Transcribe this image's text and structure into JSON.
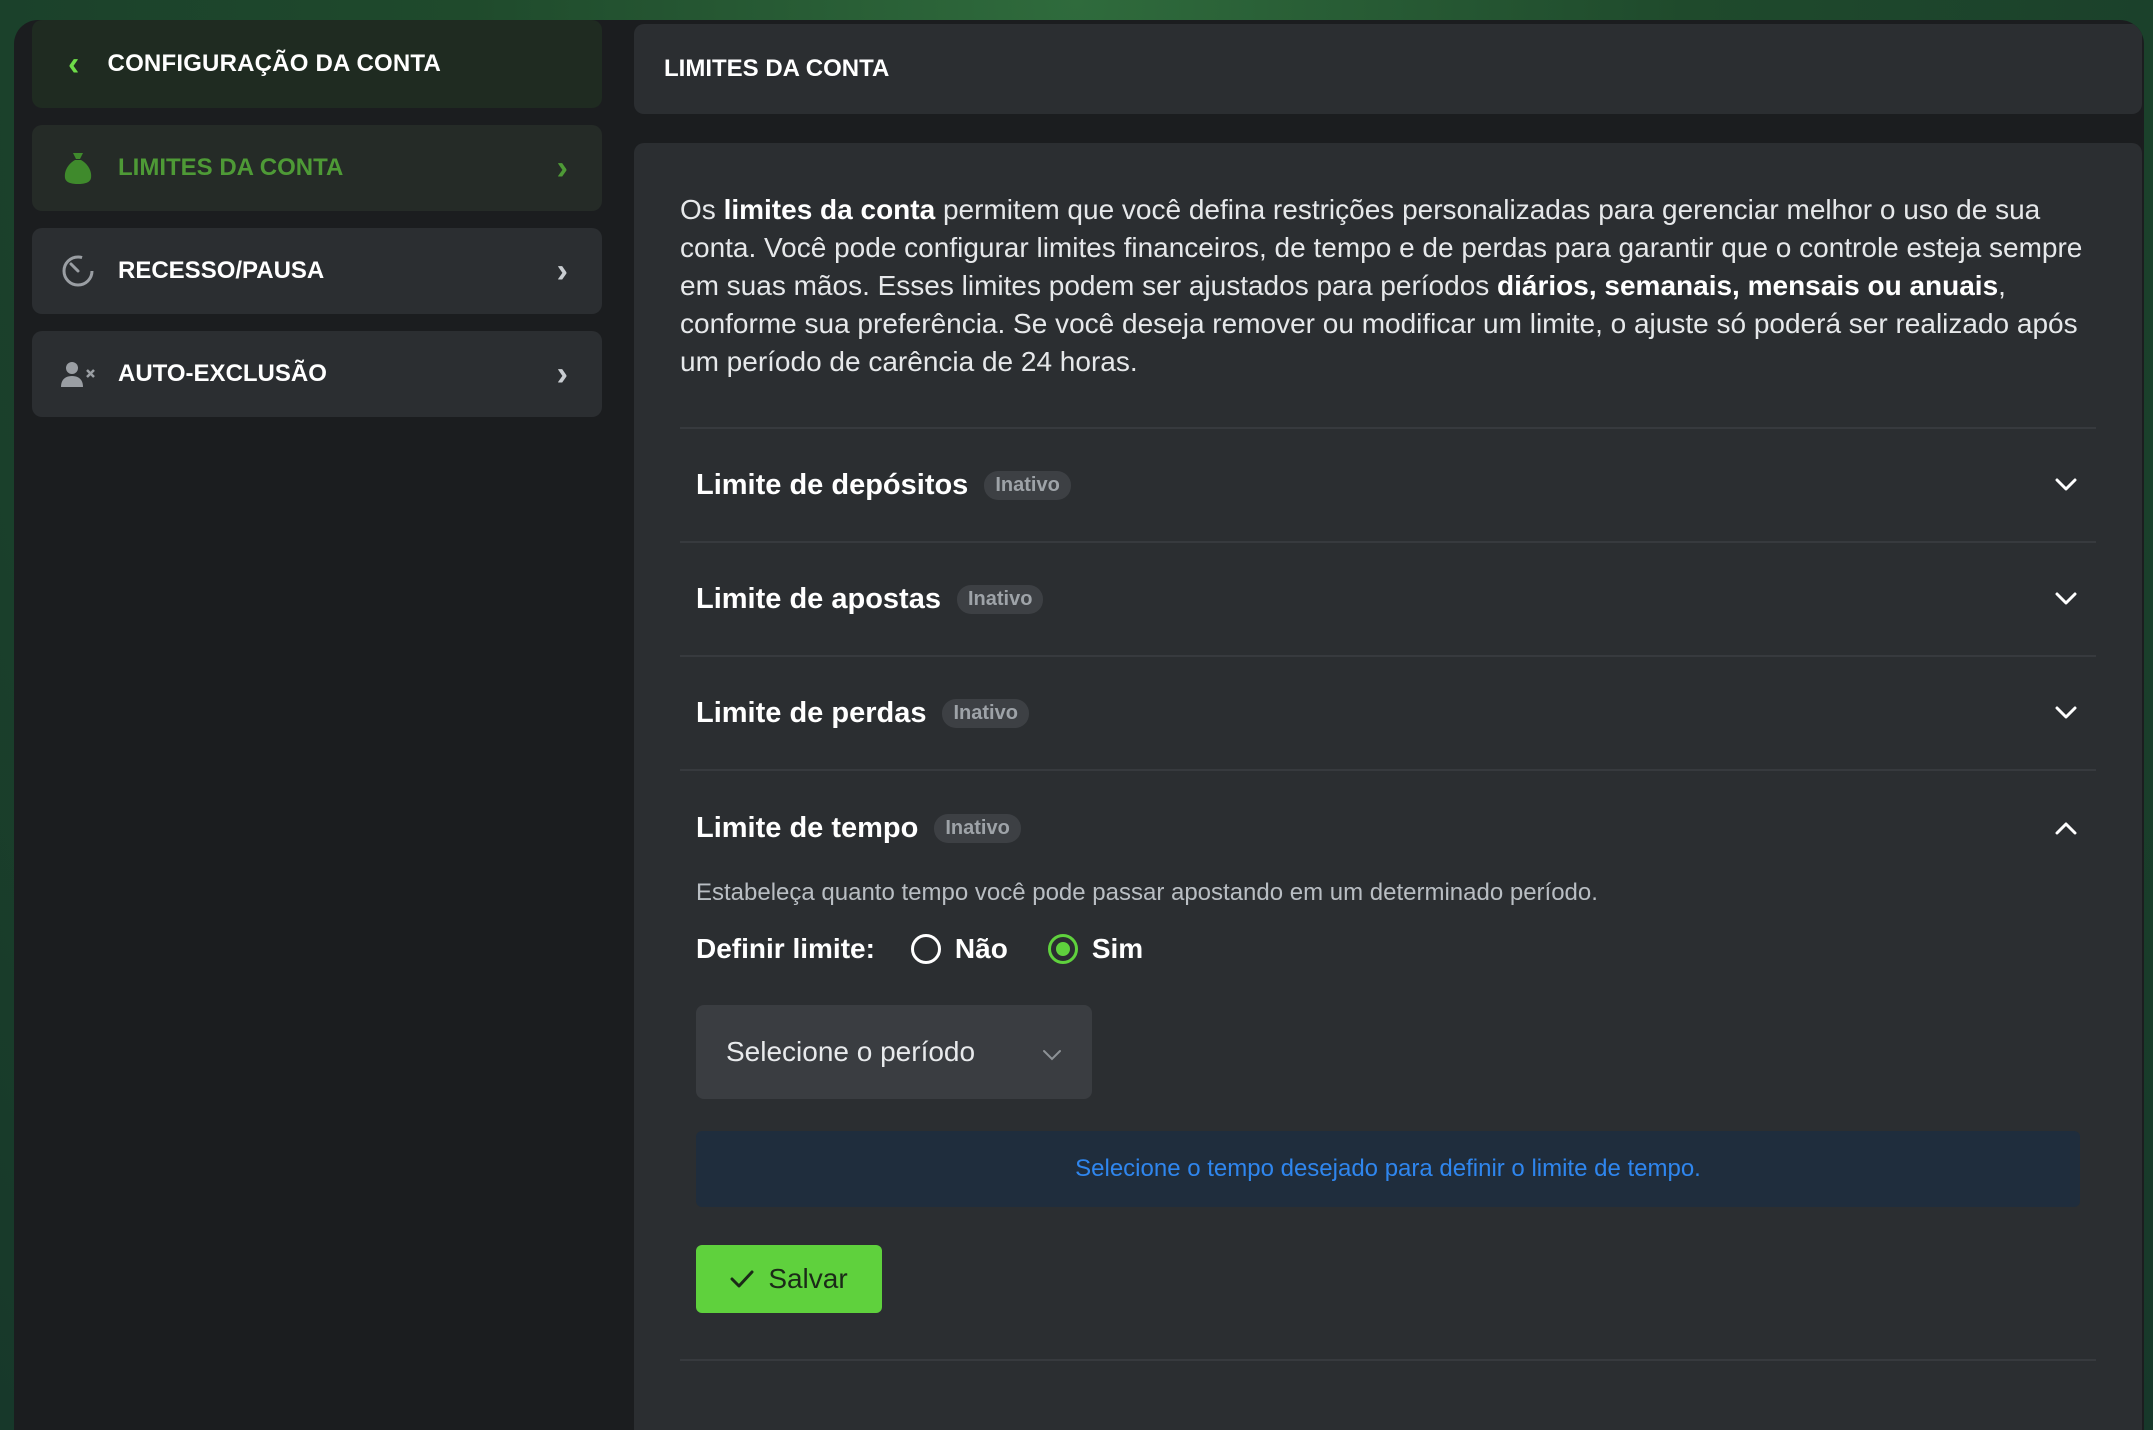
{
  "sidebar": {
    "header_title": "CONFIGURAÇÃO DA CONTA",
    "items": [
      {
        "label": "LIMITES DA CONTA",
        "icon": "money-bag-icon",
        "active": true
      },
      {
        "label": "RECESSO/PAUSA",
        "icon": "timer-icon",
        "active": false
      },
      {
        "label": "AUTO-EXCLUSÃO",
        "icon": "user-remove-icon",
        "active": false
      }
    ]
  },
  "main": {
    "title": "LIMITES DA CONTA",
    "intro": {
      "p1": "Os ",
      "b1": "limites da conta",
      "p2": " permitem que você defina restrições personalizadas para gerenciar melhor o uso de sua conta. Você pode configurar limites financeiros, de tempo e de perdas para garantir que o controle esteja sempre em suas mãos. Esses limites podem ser ajustados para períodos ",
      "b2": "diários, semanais, mensais ou anuais",
      "p3": ", conforme sua preferência. Se você deseja remover ou modificar um limite, o ajuste só poderá ser realizado após um período de carência de 24 horas."
    },
    "accordions": [
      {
        "title": "Limite de depósitos",
        "badge": "Inativo",
        "expanded": false
      },
      {
        "title": "Limite de apostas",
        "badge": "Inativo",
        "expanded": false
      },
      {
        "title": "Limite de perdas",
        "badge": "Inativo",
        "expanded": false
      }
    ],
    "time_limit": {
      "title": "Limite de tempo",
      "badge": "Inativo",
      "expanded": true,
      "description": "Estabeleça quanto tempo você pode passar apostando em um determinado período.",
      "define_label": "Definir limite:",
      "option_no": "Não",
      "option_yes": "Sim",
      "selected_option": "Sim",
      "select_placeholder": "Selecione o período",
      "info_text": "Selecione o tempo desejado para definir o limite de tempo.",
      "save_label": "Salvar"
    }
  },
  "colors": {
    "accent": "#5fd13d",
    "info_text": "#2f86ee",
    "panel": "#2b2e31",
    "background": "#1b1d1f"
  }
}
